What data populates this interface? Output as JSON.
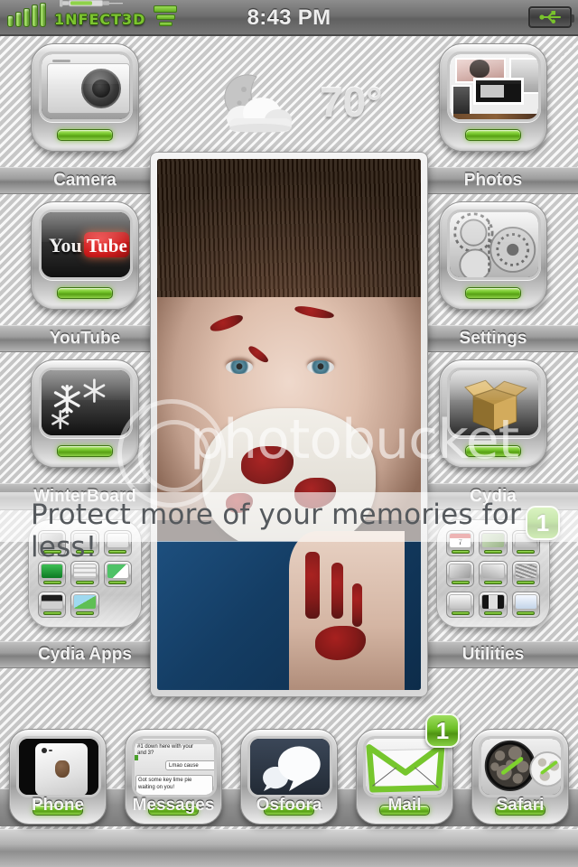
{
  "status_bar": {
    "carrier": "1NFECT3D",
    "time": "8:43 PM",
    "signal_icon": "signal-bars-icon",
    "syringe_icon": "syringe-icon",
    "wifi_icon": "wifi-icon",
    "battery_icon": "battery-usb-charging-icon",
    "signal_bars": 5,
    "wifi_bars": 3
  },
  "weather": {
    "condition_icon": "moon-cloud-icon",
    "temperature": "70°"
  },
  "home_rows": [
    {
      "left": {
        "label": "Camera",
        "icon": "camera-icon"
      },
      "right": {
        "label": "Photos",
        "icon": "photos-icon"
      }
    },
    {
      "left": {
        "label": "YouTube",
        "icon": "youtube-icon"
      },
      "right": {
        "label": "Settings",
        "icon": "settings-gears-icon"
      }
    },
    {
      "left": {
        "label": "WinterBoard",
        "icon": "winterboard-snowflake-icon"
      },
      "right": {
        "label": "Cydia",
        "icon": "cydia-box-icon"
      }
    },
    {
      "left": {
        "label": "Cydia Apps",
        "icon": "folder-icon",
        "is_folder": true
      },
      "right": {
        "label": "Utilities",
        "icon": "folder-icon",
        "is_folder": true,
        "badge": "1"
      }
    }
  ],
  "dock": [
    {
      "label": "Phone",
      "icon": "phone-iphone-icon"
    },
    {
      "label": "Messages",
      "icon": "messages-sms-icon"
    },
    {
      "label": "Osfoora",
      "icon": "osfoora-speech-bubbles-icon"
    },
    {
      "label": "Mail",
      "icon": "mail-envelope-icon",
      "badge": "1"
    },
    {
      "label": "Safari",
      "icon": "safari-compass-icon"
    }
  ],
  "messages_preview": {
    "line1": "#1 down here with your",
    "line2": "and 3?",
    "bubble": "Lmao cause",
    "line3": "Got some key lime pie",
    "line4": "waiting on you!"
  },
  "youtube_icon": {
    "text_you": "You",
    "text_tube": "Tube"
  },
  "watermark": {
    "brand": "photobucket",
    "tagline": "Protect more of your memories for less!"
  },
  "center_photo": {
    "alt": "zombie-woman-with-bloody-surgical-mask-photo"
  },
  "colors": {
    "accent_green": "#76c62d",
    "led_green": "#5ba317",
    "badge_green": "#6cbd26",
    "carrier_green": "#7cc42f",
    "statusbar_gray": "#6f6f6f",
    "label_band_gray": "#9d9d9d",
    "youtube_red": "#cc1b1b"
  }
}
